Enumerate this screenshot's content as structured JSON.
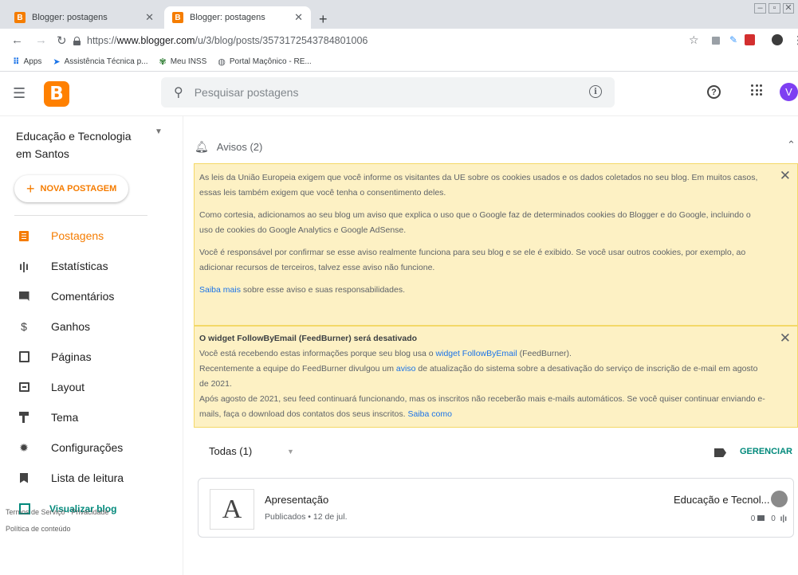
{
  "browser": {
    "tabs": [
      {
        "title": "Blogger: postagens",
        "active": false
      },
      {
        "title": "Blogger: postagens",
        "active": true
      }
    ],
    "new_tab": "+",
    "url_prefix": "https://",
    "url_domain": "www.blogger.com",
    "url_path": "/u/3/blog/posts/3573172543784801006",
    "bookmarks": [
      {
        "label": "Apps",
        "icon": "apps-grid-icon"
      },
      {
        "label": "Assistência Técnica p...",
        "icon": "arrow-icon"
      },
      {
        "label": "Meu INSS",
        "icon": "inss-icon"
      },
      {
        "label": "Portal Maçônico - RE...",
        "icon": "globe-icon"
      }
    ]
  },
  "header": {
    "logo": "B",
    "search_placeholder": "Pesquisar postagens",
    "avatar_letter": "V",
    "help": "?"
  },
  "sidebar": {
    "blog_name": "Educação e Tecnologia em Santos",
    "new_post": "NOVA POSTAGEM",
    "items": [
      {
        "label": "Postagens",
        "icon": "posts-icon",
        "active": true
      },
      {
        "label": "Estatísticas",
        "icon": "stats-icon"
      },
      {
        "label": "Comentários",
        "icon": "comments-icon"
      },
      {
        "label": "Ganhos",
        "icon": "dollar-icon"
      },
      {
        "label": "Páginas",
        "icon": "pages-icon"
      },
      {
        "label": "Layout",
        "icon": "layout-icon"
      },
      {
        "label": "Tema",
        "icon": "paint-roller-icon"
      },
      {
        "label": "Configurações",
        "icon": "gear-icon"
      },
      {
        "label": "Lista de leitura",
        "icon": "bookmark-icon"
      }
    ],
    "view_blog": "Visualizar blog",
    "footer": {
      "terms": "Termos de Serviço",
      "privacy": "Privacidade",
      "content_policy": "Política de conteúdo"
    }
  },
  "notices": {
    "header": "Avisos (2)",
    "notice1": {
      "p1": "As leis da União Europeia exigem que você informe os visitantes da UE sobre os cookies usados e os dados coletados no seu blog. Em muitos casos, essas leis também exigem que você tenha o consentimento deles.",
      "p2": "Como cortesia, adicionamos ao seu blog um aviso que explica o uso que o Google faz de determinados cookies do Blogger e do Google, incluindo o uso de cookies do Google Analytics e Google AdSense.",
      "p3": "Você é responsável por confirmar se esse aviso realmente funciona para seu blog e se ele é exibido. Se você usar outros cookies, por exemplo, ao adicionar recursos de terceiros, talvez esse aviso não funcione.",
      "p4_link": "Saiba mais",
      "p4_rest": " sobre esse aviso e suas responsabilidades."
    },
    "notice2": {
      "title": "O widget FollowByEmail (FeedBurner) será desativado",
      "l1_a": "Você está recebendo estas informações porque seu blog usa o ",
      "l1_link": "widget FollowByEmail",
      "l1_b": " (FeedBurner).",
      "l2_a": "Recentemente a equipe do FeedBurner divulgou um ",
      "l2_link": "aviso",
      "l2_b": " de atualização do sistema sobre a desativação do serviço de inscrição de e-mail em agosto de 2021.",
      "l3": "Após agosto de 2021, seu feed continuará funcionando, mas os inscritos não receberão mais e-mails automáticos. Se você quiser continuar enviando e-mails, faça o download dos contatos dos seus inscritos. ",
      "l3_link": "Saiba como"
    }
  },
  "posts": {
    "filter": "Todas (1)",
    "manage": "GERENCIAR",
    "items": [
      {
        "thumb": "A",
        "title": "Apresentação",
        "meta": "Publicados • 12 de jul.",
        "author": "Educação e Tecnol...",
        "comments": "0",
        "views": "0"
      }
    ]
  }
}
